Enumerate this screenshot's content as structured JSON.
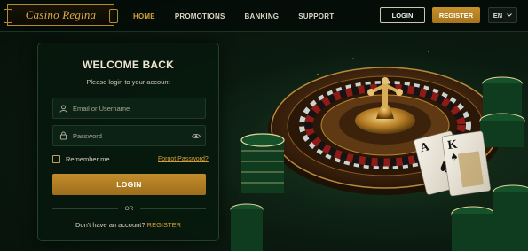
{
  "brand": {
    "logo_text": "Casino Regina"
  },
  "nav": {
    "links": [
      {
        "label": "HOME",
        "active": true
      },
      {
        "label": "PROMOTIONS",
        "active": false
      },
      {
        "label": "BANKING",
        "active": false
      },
      {
        "label": "SUPPORT",
        "active": false
      }
    ],
    "login_label": "LOGIN",
    "register_label": "REGISTER",
    "language": "EN"
  },
  "login_card": {
    "title": "WELCOME BACK",
    "subtitle": "Please login to your account",
    "username_placeholder": "Email or Username",
    "password_placeholder": "Password",
    "remember_label": "Remember me",
    "remember_checked": false,
    "forgot_label": "Forgot Password?",
    "submit_label": "LOGIN",
    "or_label": "OR",
    "signup_prompt": "Don't have an account?",
    "signup_link": "REGISTER"
  },
  "hero_art": {
    "card_ranks": [
      "A",
      "K"
    ]
  },
  "colors": {
    "gold": "#c7902a",
    "background": "#0b1a10",
    "accent_text": "#d39e37"
  },
  "icons": [
    "user-icon",
    "lock-icon",
    "eye-icon",
    "chevron-down-icon"
  ]
}
